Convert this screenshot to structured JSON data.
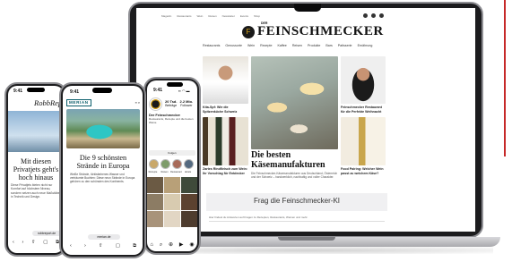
{
  "laptop": {
    "topnav": [
      "Magazin",
      "Restaurants",
      "Wein",
      "Reisen",
      "Newsletter",
      "Events",
      "Shop"
    ],
    "logo_pre": "DER",
    "logo": "FEINSCHMECKER",
    "logo_mark": "F",
    "menu": [
      "Restaurants",
      "Genussorte",
      "Wein",
      "Rezepte",
      "Kaffee",
      "Reisen",
      "Produkte",
      "Bars",
      "Patisserie",
      "Ernährung"
    ],
    "left_captions": [
      "Kita-Spf: Wie die Spitzenküche Schweiz stabilisiert",
      "Zartes Rindfleisch zum Wein: Ihr Vorschlag für Entdecker"
    ],
    "right_captions": [
      "Feinschmecker Restaurant für die Perfekte Weihnacht",
      "Food Pairing: Welcher Wein passt zu welchem Käse?"
    ],
    "hero_title": "Die besten Käsemanufakturen",
    "hero_text": "Die Feinschmecker-Käsemanufakturen aus Deutschland, Österreich und der Schweiz – handwerklich, nachhaltig und voller Charakter.",
    "ki_title": "Frag die Feinschmecker-KI",
    "ki_sub": "Hier findest du Antworten auf Fragen zu Rezepten, Restaurants, Weinen und mehr."
  },
  "phone_instagram": {
    "time": "9:41",
    "status": "▪▪ ◠ ▬",
    "stats": [
      {
        "value": "20 Tsd.",
        "label": "Beiträge"
      },
      {
        "value": "2.2 Mio.",
        "label": "Follower"
      },
      {
        "value": "1.3",
        "label": "Gefolgt"
      }
    ],
    "name": "Der Feinschmecker",
    "bio": "Restaurants, Rezepte und die besten Weine",
    "button": "Folgen",
    "highlights": [
      "Rezepte",
      "Reisen",
      "Restaurants",
      "Hotels"
    ],
    "nav_icons": [
      "⌂",
      "⌕",
      "⊕",
      "▶",
      "◉"
    ]
  },
  "phone_robb": {
    "time": "9:41",
    "logo": "RobbReport",
    "title": "Mit diesen Privatjets geht's hoch hinaus",
    "text": "Diese Privatjets bieten nicht nur Komfort auf höchstem Niveau, sondern setzen auch neue Maßstäbe in Technik und Design.",
    "url": "robbreport.de",
    "nav_icons": [
      "‹",
      "›",
      "⇧",
      "▢",
      "⧉"
    ]
  },
  "phone_merian": {
    "time": "9:41",
    "logo": "MERIAN",
    "nav": "≡ ⌕",
    "title": "Die 9 schönsten Strände in Europa",
    "text": "Weiße Strände, türkisfarbenes Wasser und verträumte Buchten: Diese neun Strände in Europa gehören zu den schönsten des Kontinents.",
    "url": "merian.de",
    "nav_icons": [
      "‹",
      "›",
      "⇧",
      "▢",
      "⧉"
    ]
  }
}
